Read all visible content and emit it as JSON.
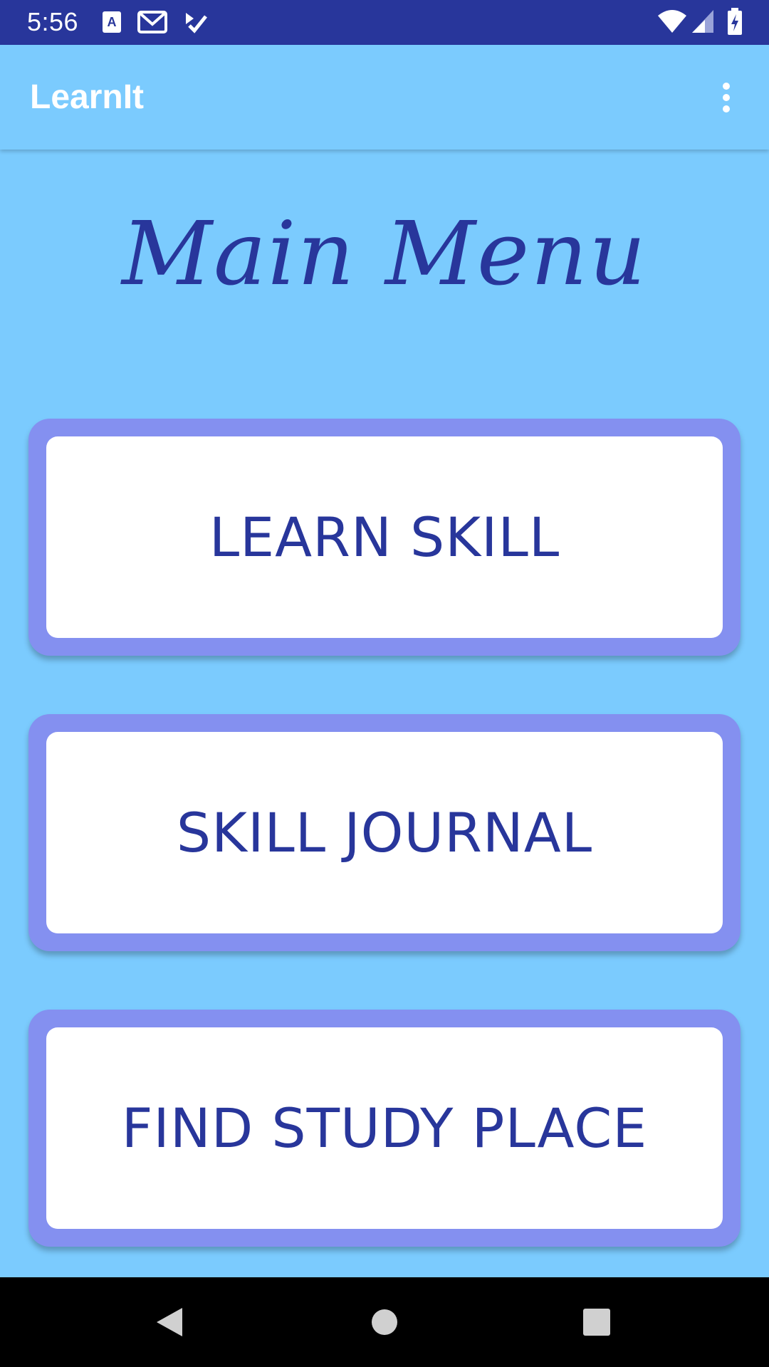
{
  "status_bar": {
    "time": "5:56",
    "left_icons": [
      "font-download-icon",
      "gmail-icon",
      "task-check-icon"
    ],
    "right_icons": [
      "wifi-icon",
      "cell-signal-icon",
      "battery-charging-icon"
    ]
  },
  "app_bar": {
    "title": "LearnIt",
    "overflow_icon": "more-vert-icon"
  },
  "main": {
    "title": "Main Menu",
    "buttons": [
      {
        "label": "LEARN SKILL"
      },
      {
        "label": "SKILL JOURNAL"
      },
      {
        "label": "FIND STUDY PLACE"
      }
    ]
  },
  "nav_bar": {
    "buttons": [
      "back-icon",
      "home-icon",
      "recents-icon"
    ]
  },
  "colors": {
    "status_bar": "#28369b",
    "background": "#7bcbfe",
    "card_border": "#8490f0",
    "text_dark": "#28369b"
  }
}
